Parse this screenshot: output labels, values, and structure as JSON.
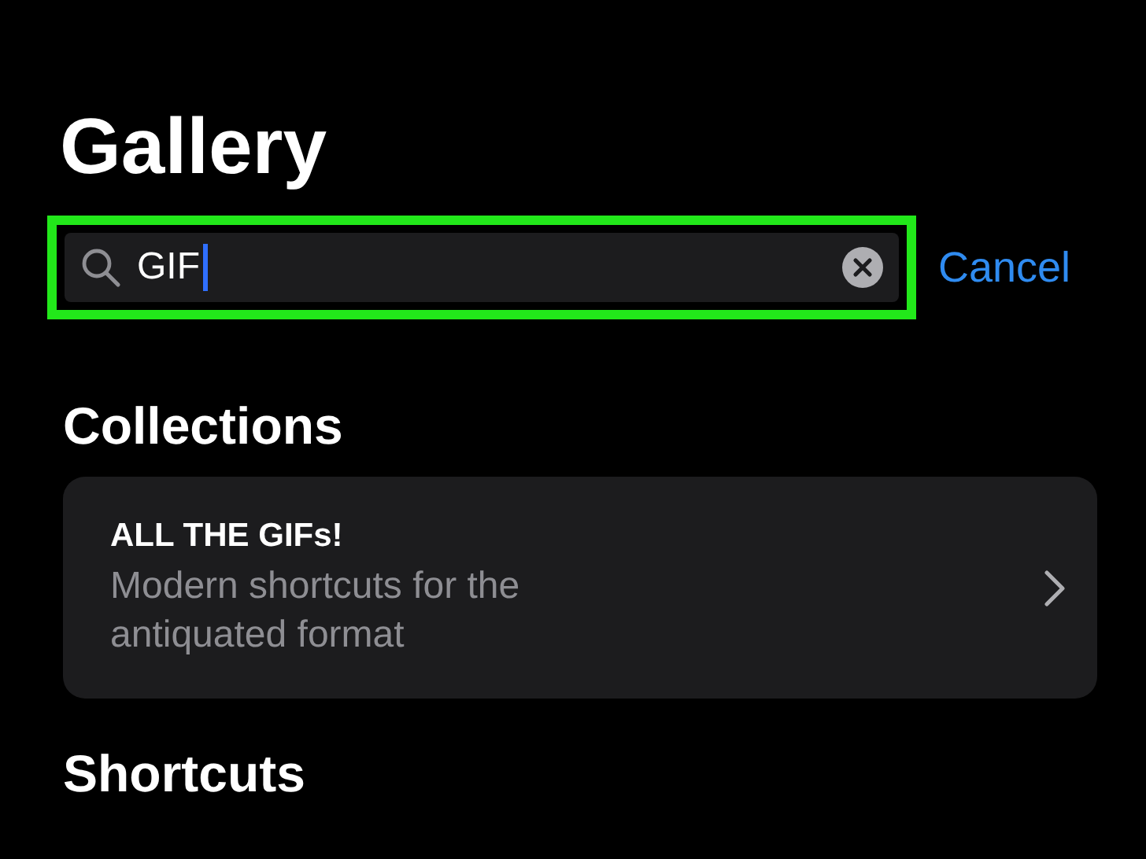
{
  "title": "Gallery",
  "search": {
    "value": "GIF",
    "focused": true,
    "highlighted": true
  },
  "cancel": "Cancel",
  "sections": [
    {
      "heading": "Collections",
      "cards": [
        {
          "title": "ALL THE GIFs!",
          "subtitle": "Modern shortcuts for the antiquated format"
        }
      ]
    },
    {
      "heading": "Shortcuts"
    }
  ]
}
